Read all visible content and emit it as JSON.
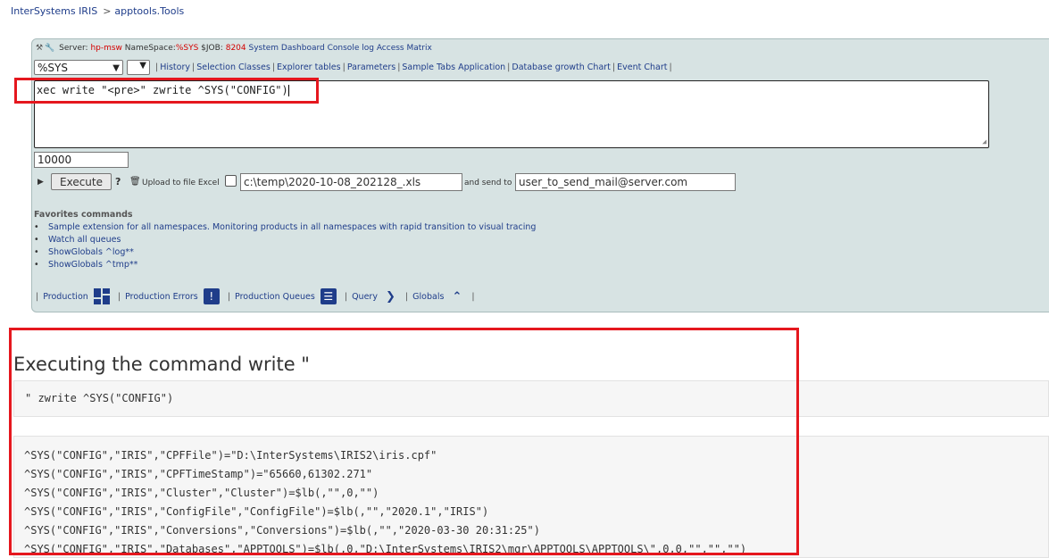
{
  "breadcrumb": {
    "home": "InterSystems IRIS",
    "separator": ">",
    "current": "apptools.Tools"
  },
  "serverline": {
    "label_server": "Server:",
    "server": "hp-msw",
    "label_namespace": "NameSpace:",
    "namespace": "%SYS",
    "label_job": "$JOB:",
    "job": "8204",
    "links": [
      "System Dashboard",
      "Console log",
      "Access Matrix"
    ]
  },
  "namespace_select": {
    "value": "%SYS"
  },
  "toplinks": [
    "History",
    "Selection Classes",
    "Explorer tables",
    "Parameters",
    "Sample Tabs Application",
    "Database growth Chart",
    "Event Chart"
  ],
  "command": {
    "value": "xec write \"<pre>\" zwrite ^SYS(\"CONFIG\")"
  },
  "maxrows": {
    "value": "10000"
  },
  "execute": {
    "button_label": "Execute",
    "help_symbol": "?",
    "upload_label": "Upload to file Excel",
    "file_path": "c:\\temp\\2020-10-08_202128_.xls",
    "send_label": "and send to",
    "email": "user_to_send_mail@server.com"
  },
  "favorites": {
    "title": "Favorites commands",
    "items": [
      "Sample extension for all namespaces. Monitoring products in all namespaces with rapid transition to visual tracing",
      "Watch all queues",
      "ShowGlobals ^log**",
      "ShowGlobals ^tmp**"
    ]
  },
  "bottomlinks": {
    "production": "Production",
    "production_errors": "Production Errors",
    "production_queues": "Production Queues",
    "query": "Query",
    "globals": "Globals"
  },
  "result": {
    "title": "Executing the command write \"",
    "command_echo": "\" zwrite ^SYS(\"CONFIG\")",
    "lines": [
      "^SYS(\"CONFIG\",\"IRIS\",\"CPFFile\")=\"D:\\InterSystems\\IRIS2\\iris.cpf\"",
      "^SYS(\"CONFIG\",\"IRIS\",\"CPFTimeStamp\")=\"65660,61302.271\"",
      "^SYS(\"CONFIG\",\"IRIS\",\"Cluster\",\"Cluster\")=$lb(,\"\",0,\"\")",
      "^SYS(\"CONFIG\",\"IRIS\",\"ConfigFile\",\"ConfigFile\")=$lb(,\"\",\"2020.1\",\"IRIS\")",
      "^SYS(\"CONFIG\",\"IRIS\",\"Conversions\",\"Conversions\")=$lb(,\"\",\"2020-03-30 20:31:25\")",
      "^SYS(\"CONFIG\",\"IRIS\",\"Databases\",\"APPTOOLS\")=$lb(,0,\"D:\\InterSystems\\IRIS2\\mgr\\APPTOOLS\\APPTOOLS\\\",0,0,\"\",\"\",\"\")"
    ]
  },
  "colors": {
    "panel_bg": "#d7e3e3",
    "link": "#1f3d8a",
    "highlight_red": "#e5171e",
    "server_red": "#d40000"
  }
}
